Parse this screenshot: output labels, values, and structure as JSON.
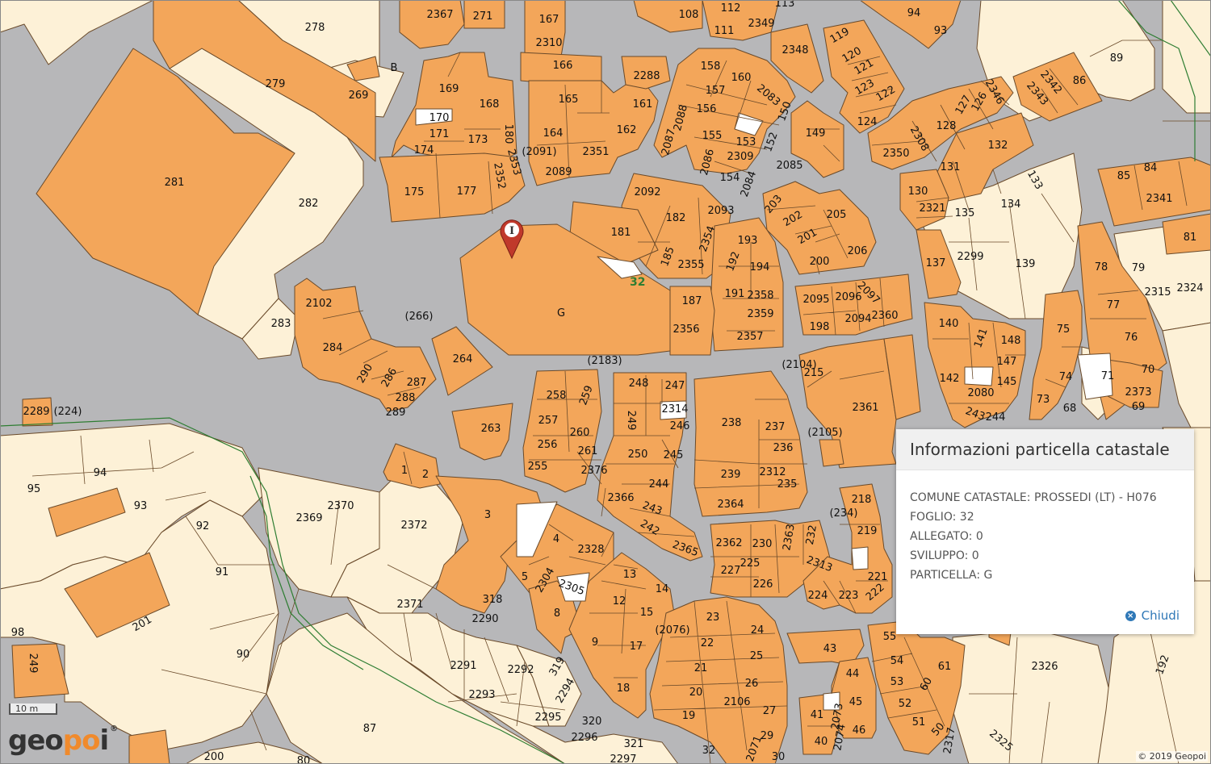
{
  "colors": {
    "road": "#b7b7b9",
    "parcel_light": "#fdf1d7",
    "building": "#f3a65a",
    "edge": "#6a4a2a",
    "sheet_border": "#2e7d32",
    "marker": "#c0392b",
    "link": "#2f78b7"
  },
  "map": {
    "selected_parcel": "G",
    "marker_icon": "info-pin-icon",
    "sheet_number": "32",
    "parcel_labels": [
      "278",
      "2367",
      "271",
      "167",
      "2310",
      "166",
      "165",
      "108",
      "112",
      "111",
      "113",
      "2349",
      "2348",
      "94",
      "93",
      "89",
      "279",
      "B",
      "269",
      "169",
      "168",
      "170",
      "171",
      "173",
      "174",
      "180",
      "2353",
      "2352",
      "175",
      "177",
      "(2091)",
      "2089",
      "2351",
      "164",
      "162",
      "2288",
      "161",
      "158",
      "160",
      "157",
      "2083",
      "156",
      "155",
      "153",
      "150",
      "149",
      "2088",
      "2087",
      "2086",
      "2309",
      "154",
      "152",
      "2084",
      "2085",
      "119",
      "120",
      "121",
      "123",
      "122",
      "124",
      "2308",
      "2350",
      "128",
      "127",
      "126",
      "2346",
      "132",
      "131",
      "130",
      "2321",
      "135",
      "134",
      "133",
      "2342",
      "2343",
      "86",
      "85",
      "84",
      "2341",
      "81",
      "281",
      "282",
      "182",
      "2092",
      "2093",
      "181",
      "2354",
      "185",
      "2355",
      "193",
      "192",
      "194",
      "203",
      "202",
      "205",
      "201",
      "200",
      "206",
      "137",
      "2299",
      "139",
      "78",
      "79",
      "2315",
      "2324",
      "G",
      "(266)",
      "283",
      "2102",
      "284",
      "290",
      "286",
      "287",
      "288",
      "289",
      "264",
      "187",
      "2356",
      "191",
      "2358",
      "2359",
      "2357",
      "2095",
      "2096",
      "2097",
      "198",
      "2094",
      "2360",
      "140",
      "141",
      "148",
      "147",
      "142",
      "145",
      "75",
      "77",
      "76",
      "74",
      "71",
      "70",
      "73",
      "68",
      "2373",
      "69",
      "(2183)",
      "258",
      "259",
      "248",
      "247",
      "2314",
      "246",
      "257",
      "249",
      "260",
      "256",
      "261",
      "250",
      "255",
      "2376",
      "245",
      "244",
      "2366",
      "243",
      "242",
      "2365",
      "238",
      "237",
      "236",
      "(2104)",
      "215",
      "2361",
      "(2105)",
      "239",
      "2312",
      "235",
      "2364",
      "2362",
      "230",
      "2363",
      "232",
      "2313",
      "227",
      "225",
      "226",
      "224",
      "223",
      "222",
      "221",
      "218",
      "219",
      "(234)",
      "2289",
      "(224)",
      "263",
      "1",
      "2",
      "3",
      "4",
      "2328",
      "5",
      "2304",
      "2305",
      "8",
      "318",
      "2290",
      "13",
      "14",
      "12",
      "15",
      "17",
      "9",
      "18",
      "(2076)",
      "23",
      "24",
      "22",
      "25",
      "21",
      "26",
      "20",
      "2106",
      "27",
      "19",
      "29",
      "32",
      "2071",
      "30",
      "43",
      "44",
      "45",
      "46",
      "41",
      "40",
      "2073",
      "2074",
      "55",
      "54",
      "53",
      "52",
      "51",
      "50",
      "60",
      "61",
      "2317",
      "2325",
      "2326",
      "192",
      "95",
      "94",
      "93",
      "92",
      "91",
      "90",
      "98",
      "249",
      "201",
      "2369",
      "2370",
      "2372",
      "2371",
      "2291",
      "2292",
      "319",
      "2294",
      "2293",
      "2295",
      "2296",
      "320",
      "321",
      "2297",
      "87",
      "200",
      "80",
      "2080",
      "243",
      "244"
    ]
  },
  "popup": {
    "title": "Informazioni particella catastale",
    "lines": [
      "COMUNE CATASTALE: PROSSEDI (LT) - H076",
      "FOGLIO: 32",
      "ALLEGATO: 0",
      "SVILUPPO: 0",
      "PARTICELLA: G"
    ],
    "close_icon": "close-circle-icon",
    "close_label": "Chiudi"
  },
  "logo": {
    "part1": "geo",
    "part2": "po",
    "part3": "i",
    "mark": "®"
  },
  "scale_label": "10 m",
  "attribution": "© 2019 Geopoi"
}
